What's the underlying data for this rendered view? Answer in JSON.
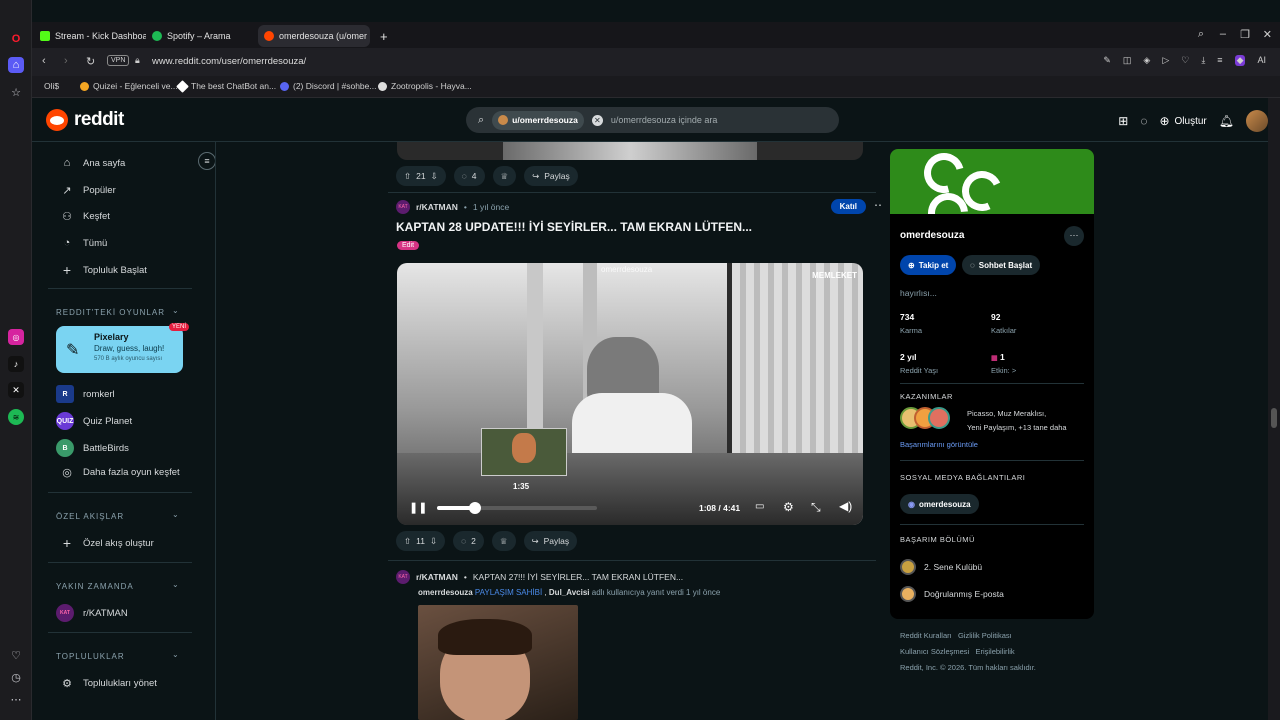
{
  "tabs": [
    {
      "label": "Stream - Kick Dashboard",
      "color": "#53fc18"
    },
    {
      "label": "Spotify – Arama",
      "color": "#1db954"
    },
    {
      "label": "omerdesouza (u/omer",
      "color": "#ff4500"
    }
  ],
  "address": {
    "vpn": "VPN",
    "url": "www.reddit.com/user/omerrdesouza/"
  },
  "bookmarks": [
    "Oli$",
    "Quizei - Eğlenceli ve...",
    "The best ChatBot an...",
    "(2) Discord | #sohbe...",
    "Zootropolis - Hayva..."
  ],
  "header": {
    "logo": "reddit",
    "search_chip": "u/omerrdesouza",
    "search_placeholder": "u/omerrdesouza içinde ara",
    "create": "Oluştur"
  },
  "nav": {
    "home": "Ana sayfa",
    "popular": "Popüler",
    "explore": "Keşfet",
    "all": "Tümü",
    "start_community": "Topluluk Başlat",
    "games_section": "REDDIT'TEKİ OYUNLAR",
    "game_name": "Pixelary",
    "game_desc": "Draw, guess, laugh!",
    "game_count": "570 B aylık oyuncu sayısı",
    "new_badge": "YENİ",
    "romkerl": "romkerl",
    "quiz_planet": "Quiz Planet",
    "battlebirds": "BattleBirds",
    "more_games": "Daha fazla oyun keşfet",
    "custom_section": "ÖZEL AKIŞLAR",
    "create_feed": "Özel akış oluştur",
    "recent_section": "YAKIN ZAMANDA",
    "recent_sub": "r/KATMAN",
    "communities_section": "TOPLULUKLAR",
    "manage": "Toplulukları yönet"
  },
  "top_actions": {
    "votes": "21",
    "comments": "4",
    "share": "Paylaş"
  },
  "post": {
    "sub": "r/KATMAN",
    "time": "1 yıl önce",
    "join": "Katıl",
    "title": "KAPTAN 28 UPDATE!!! İYİ SEYİRLER... TAM EKRAN LÜTFEN...",
    "flair": "Edit",
    "watermark": "omerrdesouza",
    "corner_tag": "MEMLEKET",
    "preview_time": "1:35",
    "time_display": "1:08 / 4:41",
    "progress": 0.24,
    "votes": "11",
    "comments": "2",
    "share": "Paylaş"
  },
  "comment": {
    "sub": "r/KATMAN",
    "title": "KAPTAN 27!!! İYİ SEYİRLER... TAM EKRAN LÜTFEN...",
    "author": "omerrdesouza",
    "op": "PAYLAŞIM SAHİBİ",
    "replied_to": "Dul_Avcisi",
    "rest": "adlı kullanıcıya yanıt verdi 1 yıl önce"
  },
  "profile": {
    "name": "omerdesouza",
    "follow": "Takip et",
    "chat": "Sohbet Başlat",
    "bio": "hayırlısı...",
    "karma_value": "734",
    "karma_label": "Karma",
    "contrib_value": "92",
    "contrib_label": "Katkılar",
    "age_value": "2 yıl",
    "age_label": "Reddit Yaşı",
    "impact_value": "1",
    "impact_label": "Etkin: >",
    "achievements_title": "KAZANIMLAR",
    "achievements_text1": "Picasso, Muz Meraklısı,",
    "achievements_text2": "Yeni Paylaşım, +13 tane daha",
    "achievements_link": "Başarımlarını görüntüle",
    "social_title": "SOSYAL MEDYA BAĞLANTILARI",
    "social_link": "omerdesouza",
    "trophy_title": "BAŞARIM BÖLÜMÜ",
    "trophy1": "2. Sene Kulübü",
    "trophy2": "Doğrulanmış E-posta"
  },
  "footer": {
    "rules": "Reddit Kuralları",
    "privacy": "Gizlilik Politikası",
    "agreement": "Kullanıcı Sözleşmesi",
    "access": "Erişilebilirlik",
    "copyright": "Reddit, Inc. © 2026. Tüm hakları saklıdır."
  }
}
